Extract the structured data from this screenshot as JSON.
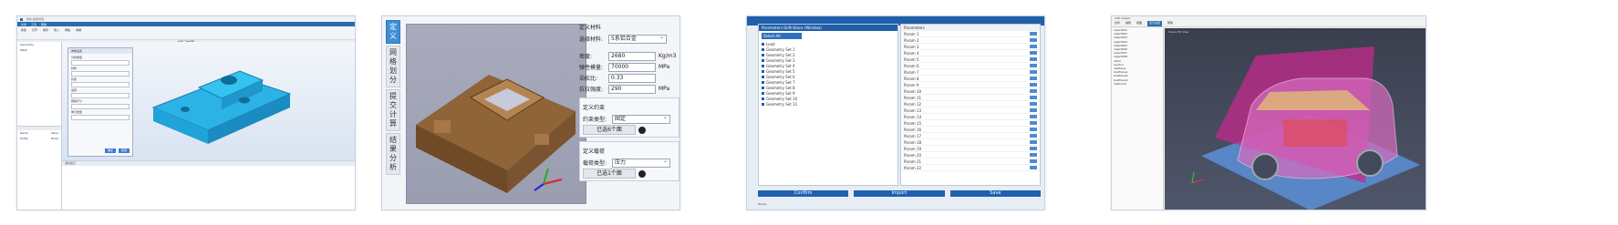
{
  "panel1": {
    "title": "软件-模型仿真",
    "menu": [
      "文件",
      "工具",
      "帮助"
    ],
    "ribbon": [
      "新建",
      "打开",
      "保存",
      "导入",
      "网格",
      "求解"
    ],
    "subtitle": "模型三维视图",
    "tree": [
      "Geometry",
      "Mesh"
    ],
    "props": [
      [
        "Name",
        "Value"
      ],
      [
        "Entity",
        "Body"
      ]
    ],
    "dialog": {
      "title": "参数设置",
      "labels": [
        "分析类型",
        "材料",
        "约束",
        "载荷",
        "网格尺寸",
        "单元类型"
      ],
      "ok": "确定",
      "cancel": "取消"
    },
    "bottom_title": "消息窗口"
  },
  "panel2": {
    "tabs": [
      "定义",
      "网格划分",
      "提交计算",
      "结果分析"
    ],
    "sec_material": "定义材料",
    "material_label": "选择材料:",
    "material_value": "5系铝合金",
    "density_label": "密度:",
    "density_value": "2680",
    "density_unit": "Kg/m3",
    "modulus_label": "弹性模量:",
    "modulus_value": "70000",
    "modulus_unit": "MPa",
    "poisson_label": "泊松比:",
    "poisson_value": "0.33",
    "strength_label": "抗拉强度:",
    "strength_value": "290",
    "strength_unit": "MPa",
    "sec_constraint": "定义约束",
    "constraint_label": "约束类型:",
    "constraint_value": "固定",
    "constraint_chosen": "已选6个面",
    "sec_load": "定义载荷",
    "load_label": "载荷类型:",
    "load_value": "压力",
    "load_chosen": "已选1个面"
  },
  "panel3": {
    "left_header": "Parameters Definitions (Window)",
    "left_sub": "Select All",
    "items": [
      "Load",
      "Geometry Set 1",
      "Geometry Set 2",
      "Geometry Set 3",
      "Geometry Set 4",
      "Geometry Set 5",
      "Geometry Set 6",
      "Geometry Set 7",
      "Geometry Set 8",
      "Geometry Set 9",
      "Geometry Set 10",
      "Geometry Set 11"
    ],
    "right_header": "Parameters",
    "rows": [
      "Param 1",
      "Param 2",
      "Param 3",
      "Param 4",
      "Param 5",
      "Param 6",
      "Param 7",
      "Param 8",
      "Param 9",
      "Param 10",
      "Param 11",
      "Param 12",
      "Param 13",
      "Param 14",
      "Param 15",
      "Param 16",
      "Param 17",
      "Param 18",
      "Param 19",
      "Param 20",
      "Param 21",
      "Param 22"
    ],
    "buttons": [
      "Confirm",
      "Import",
      "Save"
    ],
    "status": "Ready"
  },
  "panel4": {
    "title": "CAE Viewer",
    "menu": [
      "文件",
      "编辑",
      "视图",
      "显示设置",
      "帮助"
    ],
    "active_menu": "显示设置",
    "side": [
      "object001",
      "object002",
      "object003",
      "object004",
      "object005",
      "object006",
      "object007",
      "object008",
      "",
      "other",
      "section",
      "",
      "clipPlane",
      "",
      "boxPlane1",
      "boxPlane2",
      "boxPlane3",
      "",
      "",
      "clipboard"
    ],
    "view_label": "Scene 3D View"
  }
}
